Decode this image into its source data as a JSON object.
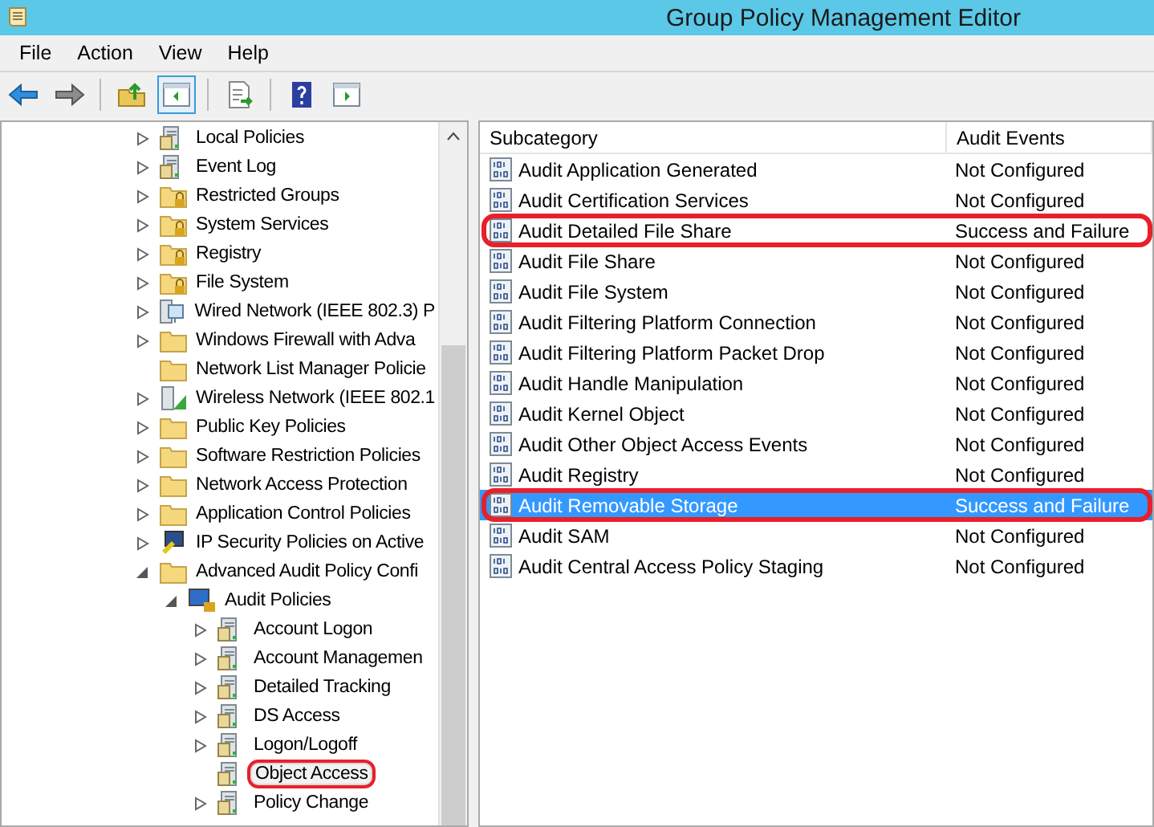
{
  "window": {
    "title": "Group Policy Management Editor"
  },
  "menu": [
    "File",
    "Action",
    "View",
    "Help"
  ],
  "toolbar": [
    {
      "kind": "back",
      "pressed": false
    },
    {
      "kind": "forward",
      "pressed": false
    },
    {
      "kind": "sep"
    },
    {
      "kind": "up",
      "pressed": false
    },
    {
      "kind": "tree",
      "pressed": true
    },
    {
      "kind": "sep"
    },
    {
      "kind": "export",
      "pressed": false
    },
    {
      "kind": "sep"
    },
    {
      "kind": "help",
      "pressed": false
    },
    {
      "kind": "action",
      "pressed": false
    }
  ],
  "tree": [
    {
      "label": "Local Policies",
      "kind": "server",
      "expanded": false,
      "selected": false,
      "circled": false
    },
    {
      "label": "Event Log",
      "kind": "server",
      "expanded": false,
      "selected": false,
      "circled": false
    },
    {
      "label": "Restricted Groups",
      "kind": "folder-lock",
      "expanded": false,
      "selected": false,
      "circled": false
    },
    {
      "label": "System Services",
      "kind": "folder-lock",
      "expanded": false,
      "selected": false,
      "circled": false
    },
    {
      "label": "Registry",
      "kind": "folder-lock",
      "expanded": false,
      "selected": false,
      "circled": false
    },
    {
      "label": "File System",
      "kind": "folder-lock",
      "expanded": false,
      "selected": false,
      "circled": false
    },
    {
      "label": "Wired Network (IEEE 802.3) P",
      "kind": "network",
      "expanded": false,
      "selected": false,
      "circled": false
    },
    {
      "label": "Windows Firewall with Adva",
      "kind": "folder",
      "expanded": false,
      "selected": false,
      "circled": false
    },
    {
      "label": "Network List Manager Policie",
      "kind": "folder",
      "expandable": false,
      "selected": false,
      "circled": false
    },
    {
      "label": "Wireless Network (IEEE 802.1",
      "kind": "wireless",
      "expanded": false,
      "selected": false,
      "circled": false
    },
    {
      "label": "Public Key Policies",
      "kind": "folder",
      "expanded": false,
      "selected": false,
      "circled": false
    },
    {
      "label": "Software Restriction Policies",
      "kind": "folder",
      "expanded": false,
      "selected": false,
      "circled": false
    },
    {
      "label": "Network Access Protection",
      "kind": "folder",
      "expanded": false,
      "selected": false,
      "circled": false
    },
    {
      "label": "Application Control Policies",
      "kind": "folder",
      "expanded": false,
      "selected": false,
      "circled": false
    },
    {
      "label": "IP Security Policies on Active",
      "kind": "ip-security",
      "expanded": false,
      "selected": false,
      "circled": false
    },
    {
      "label": "Advanced Audit Policy Confi",
      "kind": "folder",
      "expanded": true,
      "selected": false,
      "circled": false,
      "children": [
        {
          "label": "Audit Policies",
          "kind": "audit-root",
          "expanded": true,
          "selected": false,
          "circled": false,
          "children": [
            {
              "label": "Account Logon",
              "kind": "server",
              "expanded": false,
              "selected": false,
              "circled": false
            },
            {
              "label": "Account Managemen",
              "kind": "server",
              "expanded": false,
              "selected": false,
              "circled": false
            },
            {
              "label": "Detailed Tracking",
              "kind": "server",
              "expanded": false,
              "selected": false,
              "circled": false
            },
            {
              "label": "DS Access",
              "kind": "server",
              "expanded": false,
              "selected": false,
              "circled": false
            },
            {
              "label": "Logon/Logoff",
              "kind": "server",
              "expanded": false,
              "selected": false,
              "circled": false
            },
            {
              "label": "Object Access",
              "kind": "server",
              "expandable": false,
              "selected": true,
              "circled": true
            },
            {
              "label": "Policy Change",
              "kind": "server",
              "expanded": false,
              "selected": false,
              "circled": false
            }
          ]
        }
      ]
    }
  ],
  "table": {
    "columns": [
      "Subcategory",
      "Audit Events"
    ],
    "rows": [
      {
        "subcategory": "Audit Application Generated",
        "audit_events": "Not Configured",
        "selected": false,
        "circled": false
      },
      {
        "subcategory": "Audit Certification Services",
        "audit_events": "Not Configured",
        "selected": false,
        "circled": false
      },
      {
        "subcategory": "Audit Detailed File Share",
        "audit_events": "Success and Failure",
        "selected": false,
        "circled": true
      },
      {
        "subcategory": "Audit File Share",
        "audit_events": "Not Configured",
        "selected": false,
        "circled": false
      },
      {
        "subcategory": "Audit File System",
        "audit_events": "Not Configured",
        "selected": false,
        "circled": false
      },
      {
        "subcategory": "Audit Filtering Platform Connection",
        "audit_events": "Not Configured",
        "selected": false,
        "circled": false
      },
      {
        "subcategory": "Audit Filtering Platform Packet Drop",
        "audit_events": "Not Configured",
        "selected": false,
        "circled": false
      },
      {
        "subcategory": "Audit Handle Manipulation",
        "audit_events": "Not Configured",
        "selected": false,
        "circled": false
      },
      {
        "subcategory": "Audit Kernel Object",
        "audit_events": "Not Configured",
        "selected": false,
        "circled": false
      },
      {
        "subcategory": "Audit Other Object Access Events",
        "audit_events": "Not Configured",
        "selected": false,
        "circled": false
      },
      {
        "subcategory": "Audit Registry",
        "audit_events": "Not Configured",
        "selected": false,
        "circled": false
      },
      {
        "subcategory": "Audit Removable Storage",
        "audit_events": "Success and Failure",
        "selected": true,
        "circled": true
      },
      {
        "subcategory": "Audit SAM",
        "audit_events": "Not Configured",
        "selected": false,
        "circled": false
      },
      {
        "subcategory": "Audit Central Access Policy Staging",
        "audit_events": "Not Configured",
        "selected": false,
        "circled": false
      }
    ]
  }
}
